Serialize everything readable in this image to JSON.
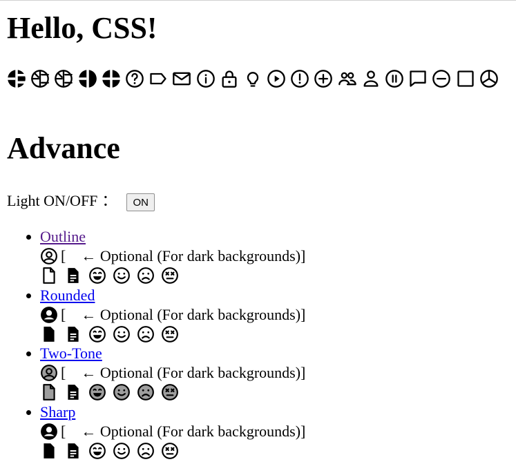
{
  "page": {
    "title": "Hello, CSS!",
    "section_title": "Advance",
    "light_label": "Light ON/OFF",
    "colon": "：",
    "toggle_value": "ON"
  },
  "top_icons": [
    "logo-mark-icon",
    "logo-mark-outline-icon",
    "logo-mark-outline-2-icon",
    "logo-mark-solid-icon",
    "logo-mark-solid-2-icon",
    "help-circle-icon",
    "tag-icon",
    "mail-icon",
    "info-icon",
    "lock-icon",
    "bulb-icon",
    "play-circle-icon",
    "alert-circle-icon",
    "plus-circle-icon",
    "group-icon",
    "user-icon",
    "pause-circle-icon",
    "message-icon",
    "minus-circle-icon",
    "square-icon",
    "pie-icon"
  ],
  "variants": [
    {
      "name": "Outline",
      "style": "outline",
      "visited": true
    },
    {
      "name": "Rounded",
      "style": "filled",
      "visited": false
    },
    {
      "name": "Two-Tone",
      "style": "twotone",
      "visited": false
    },
    {
      "name": "Sharp",
      "style": "sharp",
      "visited": false
    }
  ],
  "optional_text": {
    "open_bracket": "[",
    "arrow_text": "← Optional (For dark backgrounds)]"
  },
  "variant_icons": [
    "file-icon",
    "document-lines-icon",
    "grin-icon",
    "smile-icon",
    "sad-icon",
    "dizzy-icon"
  ]
}
